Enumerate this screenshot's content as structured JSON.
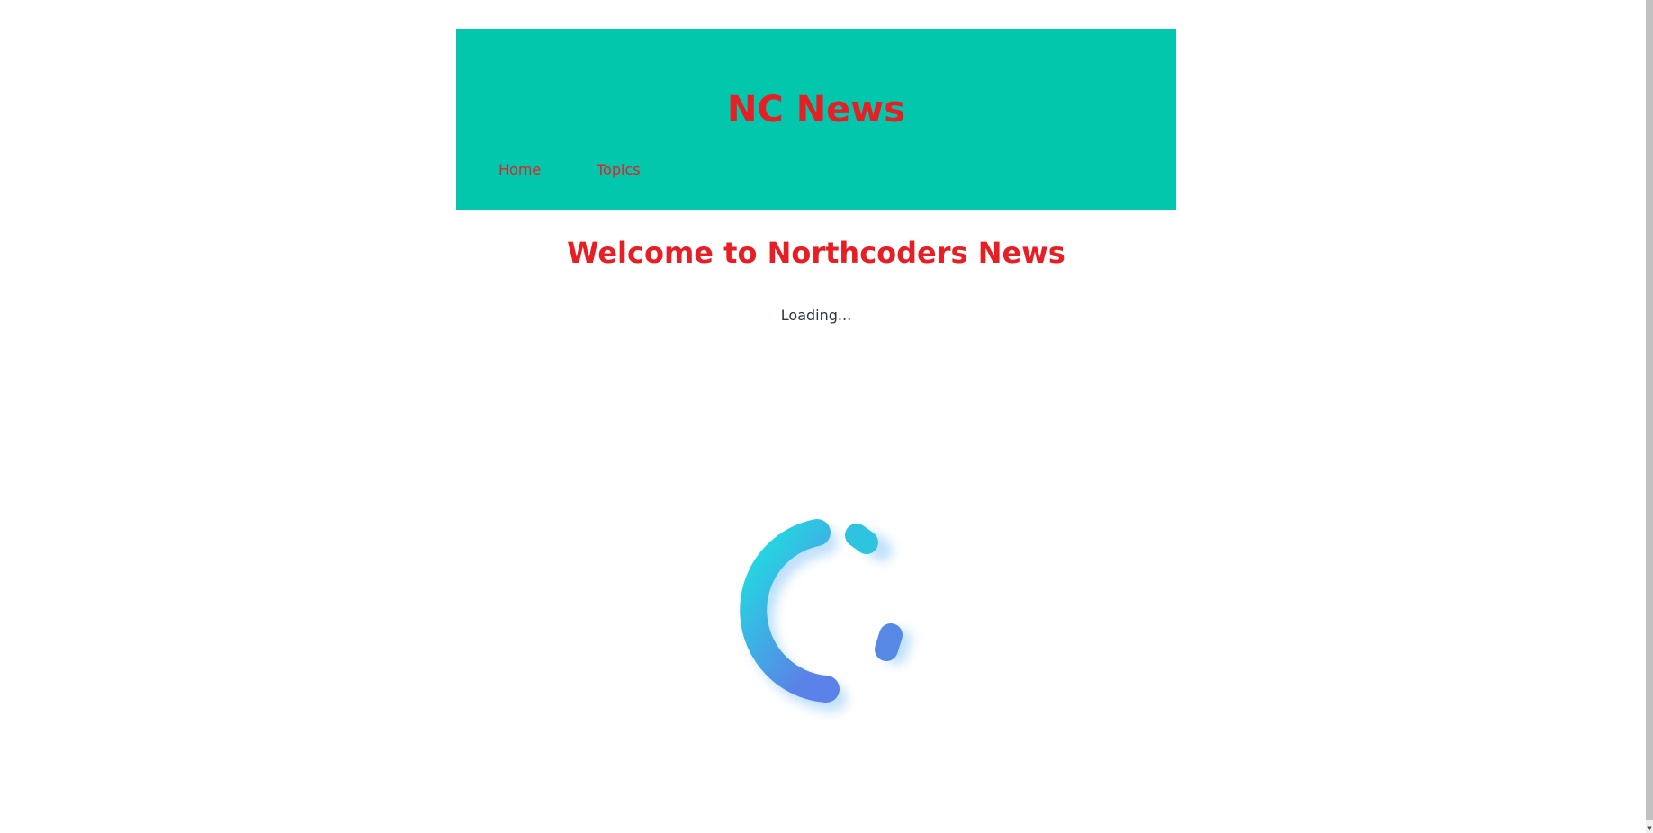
{
  "header": {
    "title": "NC News",
    "nav": {
      "home_label": "Home",
      "topics_label": "Topics"
    }
  },
  "main": {
    "welcome": "Welcome to Northcoders News",
    "loading_text": "Loading..."
  },
  "spinner": {
    "icon": "loading-spinner-icon",
    "gradient_start": "#1de2e0",
    "gradient_end": "#5b82e8"
  },
  "colors": {
    "header_background": "#02c7ad",
    "accent_red": "#e71f25",
    "body_text": "#2c3440",
    "page_background": "#ffffff"
  }
}
